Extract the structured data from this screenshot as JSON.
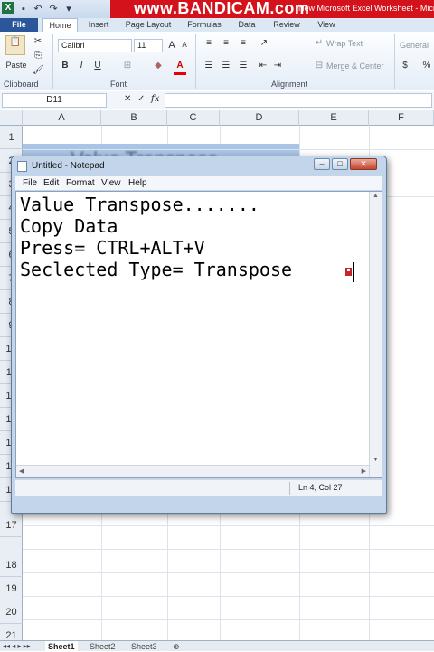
{
  "excel": {
    "file_tab": "File",
    "tabs": [
      "Home",
      "Insert",
      "Page Layout",
      "Formulas",
      "Data",
      "Review",
      "View"
    ],
    "watermark": "www.BANDICAM.com",
    "doc_title": "New Microsoft Excel Worksheet - Micro",
    "ribbon": {
      "clipboard_label": "Clipboard",
      "paste_label": "Paste",
      "font_label": "Font",
      "alignment_label": "Alignment",
      "font_name": "Calibri",
      "font_size": "11",
      "wrap_text": "Wrap Text",
      "merge_center": "Merge & Center",
      "number_format": "General",
      "currency": "$",
      "percent": "%"
    },
    "formula_bar": {
      "name_box": "D11",
      "fx": "fx"
    },
    "columns": [
      "A",
      "B",
      "C",
      "D",
      "E",
      "F"
    ],
    "rows": [
      "1",
      "2",
      "3",
      "4",
      "5",
      "6",
      "7",
      "8",
      "9",
      "10",
      "11",
      "12",
      "13",
      "14",
      "15",
      "16",
      "17",
      "18",
      "19",
      "20",
      "21"
    ],
    "cell_value": "Value Transpose",
    "sheets": [
      "Sheet1",
      "Sheet2",
      "Sheet3"
    ]
  },
  "notepad": {
    "title": "Untitled - Notepad",
    "menu": [
      "File",
      "Edit",
      "Format",
      "View",
      "Help"
    ],
    "lines": [
      "Value Transpose.......",
      "Copy Data",
      "Press= CTRL+ALT+V",
      "Seclected Type= Transpose"
    ],
    "status": "Ln 4, Col 27"
  },
  "colors": {
    "file_tab": "#2b579a",
    "bandicam": "#d4121b",
    "selection": "#a9c4e4",
    "excel_green": "#1e7145"
  },
  "icons": [
    "excel-logo-icon",
    "save-icon",
    "undo-icon",
    "redo-icon",
    "cut-icon",
    "copy-icon",
    "format-painter-icon",
    "bold-icon",
    "italic-icon",
    "underline-icon",
    "font-color-icon",
    "fill-color-icon",
    "align-left-icon",
    "align-center-icon",
    "align-right-icon",
    "notepad-icon",
    "minimize-icon",
    "maximize-icon",
    "close-icon"
  ]
}
